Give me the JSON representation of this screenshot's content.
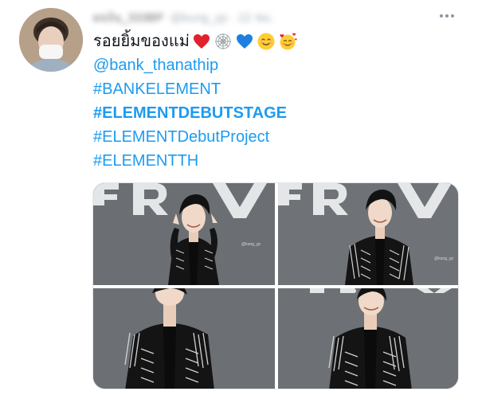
{
  "author": {
    "display_name_blurred": "ผจง์น_333BP",
    "handle_blurred": "@kung_yp · 22 ชม."
  },
  "menu": {
    "more_icon": "ellipsis-icon"
  },
  "tweet": {
    "text": "รอยยิ้มของแม่",
    "emojis": [
      "red-heart",
      "spider-web",
      "blue-heart",
      "smiling-face",
      "smiling-face-with-hearts"
    ],
    "mention": "@bank_thanathip",
    "hashtags": [
      {
        "text": "#BANKELEMENT",
        "bold": false
      },
      {
        "text": "#ELEMENTDEBUTSTAGE",
        "bold": true
      },
      {
        "text": "#ELEMENTDebutProject",
        "bold": false
      },
      {
        "text": "#ELEMENTTH",
        "bold": false
      }
    ]
  },
  "media": {
    "count": 4,
    "backdrop_letters": "ERV",
    "watermark": "@kung_yp",
    "colors": {
      "backdrop": "#6b6f73",
      "letters": "#eef0f1",
      "jacket": "#141414",
      "skin": "#f0d9c8",
      "hair": "#121212"
    }
  },
  "colors": {
    "link": "#1d9bf0",
    "text": "#0f1419",
    "muted": "#8a97a3"
  }
}
